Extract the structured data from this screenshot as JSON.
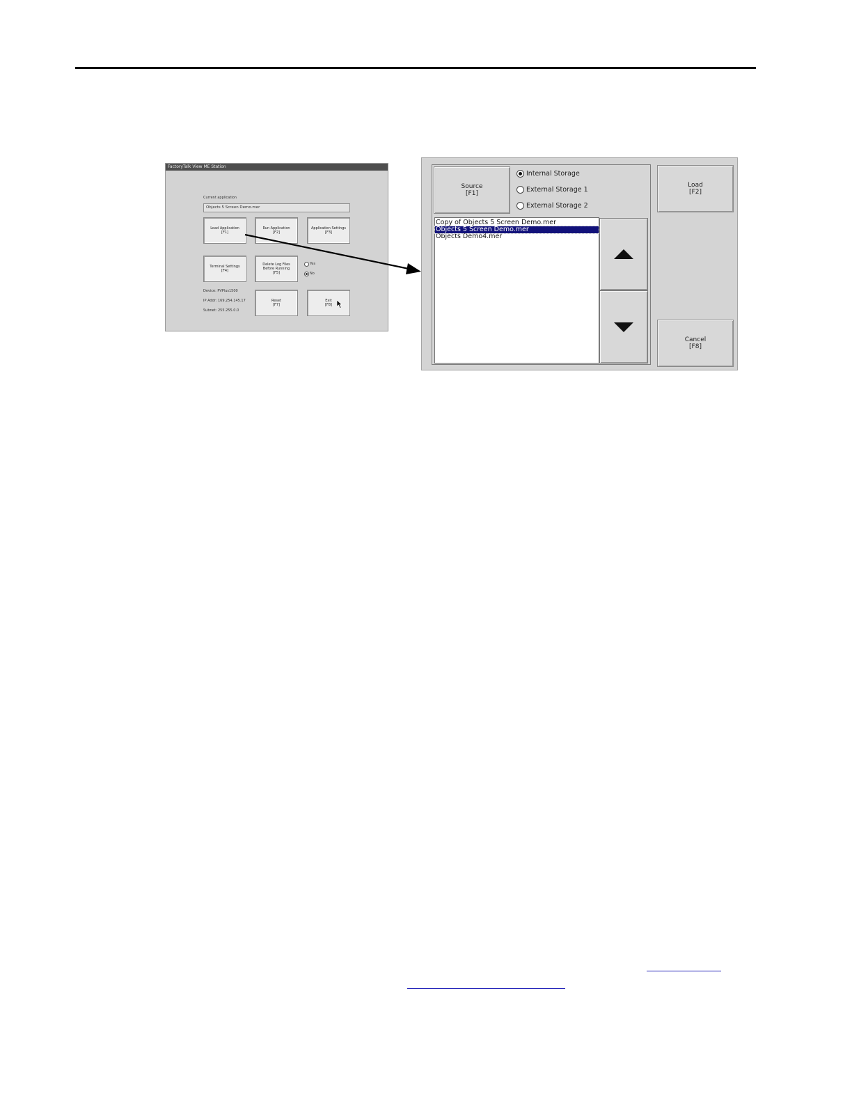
{
  "station": {
    "title": "FactoryTalk View ME Station",
    "current_app_label": "Current application",
    "current_app_value": "Objects 5 Screen Demo.mer",
    "buttons": {
      "load_app": [
        "Load Application",
        "[F1]"
      ],
      "run_app": [
        "Run Application",
        "[F2]"
      ],
      "app_settings": [
        "Application Settings",
        "[F3]"
      ],
      "terminal_settings": [
        "Terminal Settings",
        "[F4]"
      ],
      "delete_logs": [
        "Delete Log Files",
        "Before Running",
        "[F5]"
      ],
      "reset": [
        "Reset",
        "[F7]"
      ],
      "exit": [
        "Exit",
        "[F8]"
      ]
    },
    "delete_logs_yes": "Yes",
    "delete_logs_no": "No",
    "device": "Device: PVPlus1500",
    "ip": "IP Addr: 169.254.145.17",
    "subnet": "Subnet: 255.255.0.0"
  },
  "dialog": {
    "source_button": [
      "Source",
      "[F1]"
    ],
    "storage_options": [
      "Internal Storage",
      "External Storage 1",
      "External Storage 2"
    ],
    "selected_storage_index": 0,
    "files": [
      "Copy of Objects 5 Screen Demo.mer",
      "Objects 5 Screen Demo.mer",
      "Objects Demo4.mer"
    ],
    "selected_file_index": 1,
    "load_button": [
      "Load",
      "[F2]"
    ],
    "cancel_button": [
      "Cancel",
      "[F8]"
    ]
  },
  "colors": {
    "selection": "#12127a",
    "link": "#2323b8"
  }
}
